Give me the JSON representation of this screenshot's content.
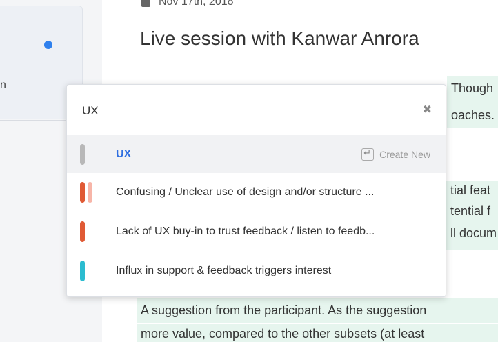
{
  "sidebar": {
    "partial_text": "n"
  },
  "session": {
    "date": "Nov 17th, 2018",
    "title": "Live session with Kanwar Anrora"
  },
  "highlights": [
    "Though",
    "oaches.",
    "tial feat",
    "tential f",
    "ll docum",
    "A suggestion from the participant. As the suggestion",
    "more value, compared to the other subsets (at least"
  ],
  "tag_picker": {
    "query": "UX",
    "create_new_label": "Create New",
    "options": [
      {
        "label": "UX",
        "colors": [
          "#b8b8b8"
        ],
        "selected": true
      },
      {
        "label": "Confusing / Unclear use of design and/or structure ...",
        "colors": [
          "#e05a35",
          "#f7b5a8"
        ],
        "selected": false
      },
      {
        "label": "Lack of UX buy-in to trust feedback / listen to feedb...",
        "colors": [
          "#e05a35"
        ],
        "selected": false
      },
      {
        "label": "Influx in support & feedback triggers interest",
        "colors": [
          "#2bbcd0"
        ],
        "selected": false
      }
    ]
  },
  "colors": {
    "accent": "#2f80ed",
    "highlight": "#e6f5ee"
  }
}
